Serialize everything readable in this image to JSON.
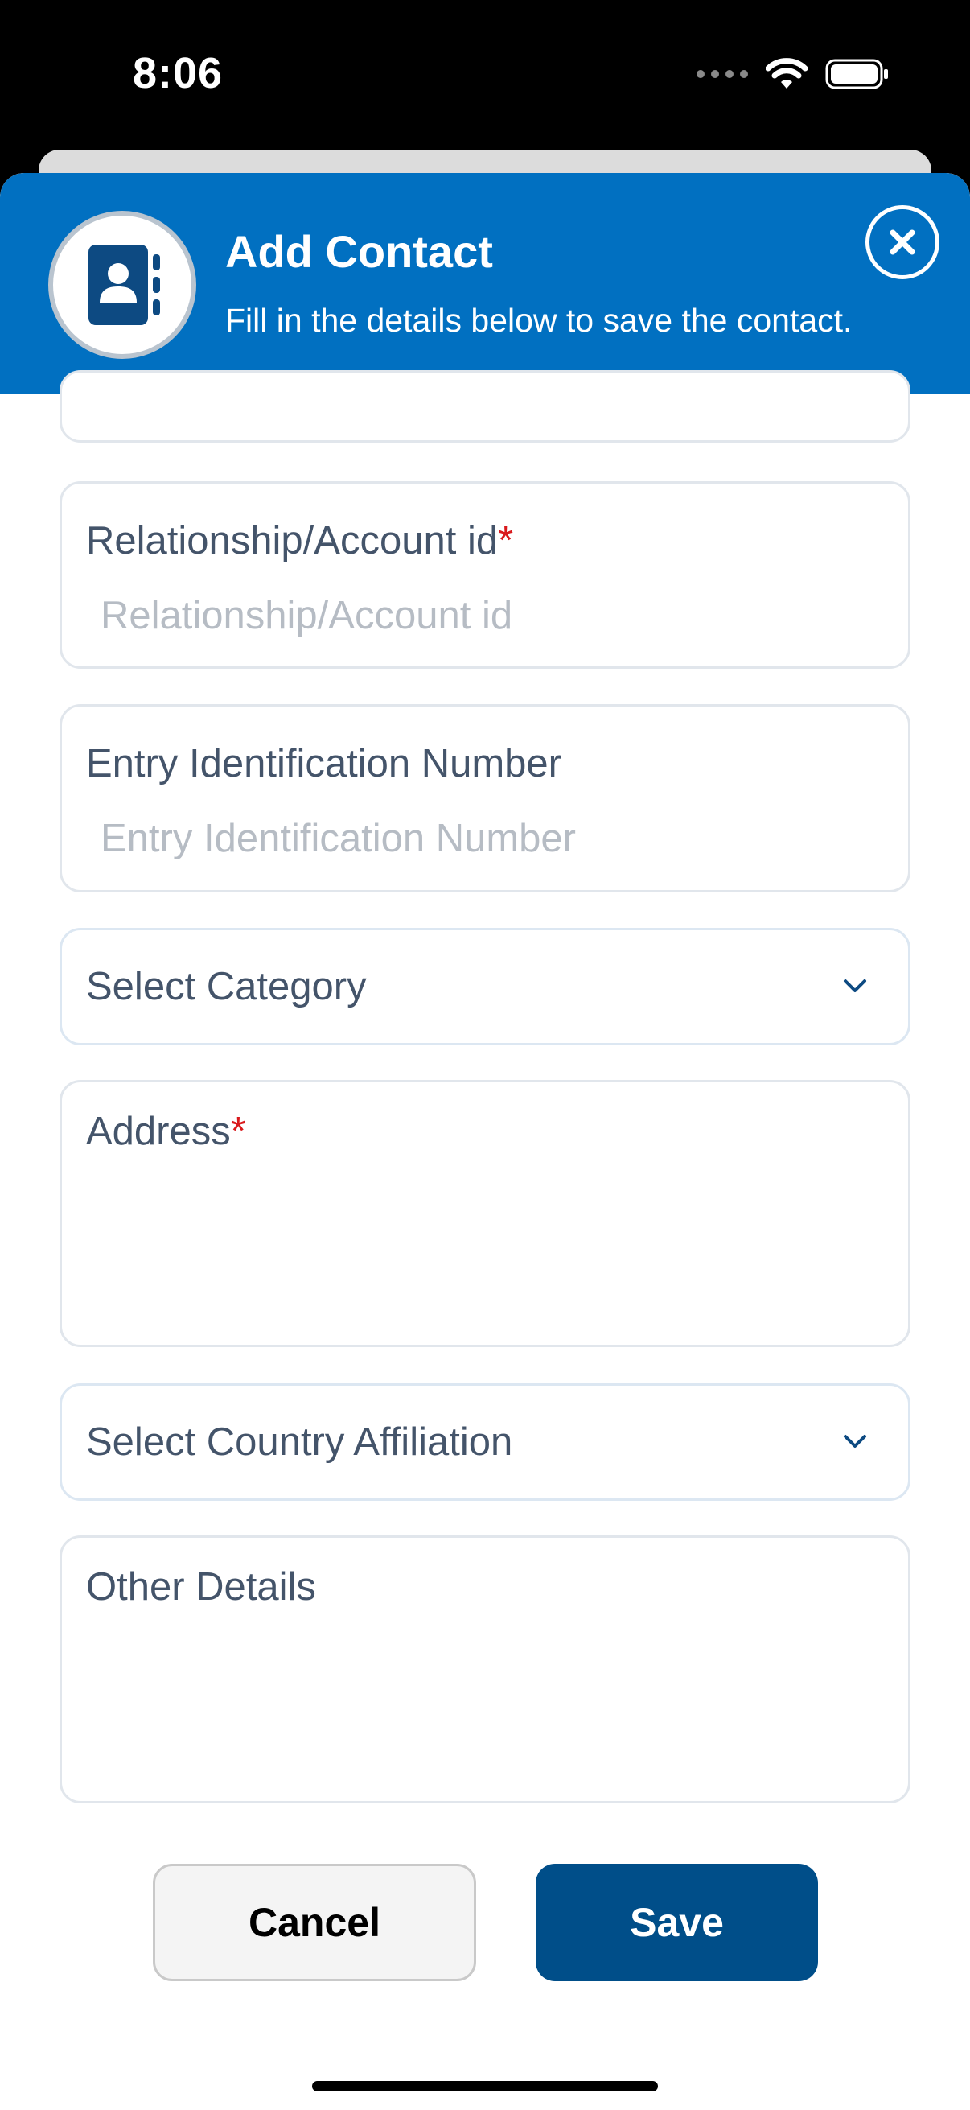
{
  "status": {
    "time": "8:06"
  },
  "header": {
    "title": "Add Contact",
    "subtitle": "Fill in the details below to save the contact.",
    "accent_color": "#0170C1"
  },
  "form": {
    "relationship": {
      "label": "Relationship/Account id",
      "required_mark": "*",
      "placeholder": "Relationship/Account id"
    },
    "entry_id": {
      "label": "Entry Identification Number",
      "placeholder": "Entry Identification Number"
    },
    "category": {
      "label": "Select Category"
    },
    "address": {
      "label": "Address",
      "required_mark": "*"
    },
    "country": {
      "label": "Select Country Affiliation"
    },
    "other": {
      "label": "Other Details"
    }
  },
  "actions": {
    "cancel_label": "Cancel",
    "save_label": "Save",
    "save_color": "#004E89"
  }
}
